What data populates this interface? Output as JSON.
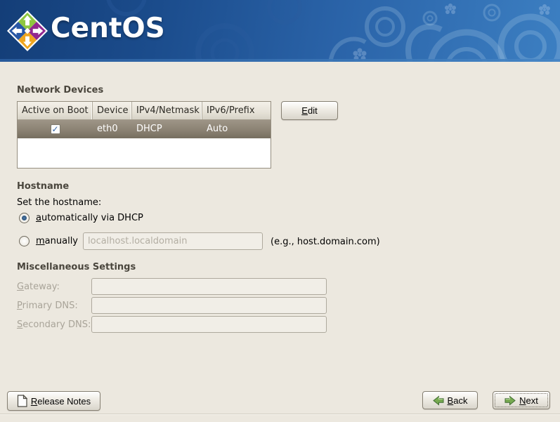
{
  "header": {
    "brand": "CentOS"
  },
  "network": {
    "title": "Network Devices",
    "edit_button": {
      "key": "E",
      "post": "dit"
    },
    "table": {
      "headers": [
        "Active on Boot",
        "Device",
        "IPv4/Netmask",
        "IPv6/Prefix"
      ],
      "rows": [
        {
          "active_on_boot": true,
          "device": "eth0",
          "ipv4": "DHCP",
          "ipv6": "Auto",
          "selected": true
        }
      ]
    }
  },
  "hostname": {
    "title": "Hostname",
    "prompt": "Set the hostname:",
    "auto_option": {
      "key": "a",
      "post": "utomatically via DHCP",
      "selected": true
    },
    "manual_option": {
      "key": "m",
      "post": "anually",
      "selected": false
    },
    "manual_input": {
      "value": "localhost.localdomain",
      "disabled": true
    },
    "example_hint": "(e.g., host.domain.com)"
  },
  "misc": {
    "title": "Miscellaneous Settings",
    "fields": [
      {
        "key": "G",
        "post": "ateway:",
        "value": "",
        "disabled": true
      },
      {
        "key": "P",
        "post": "rimary DNS:",
        "value": "",
        "disabled": true
      },
      {
        "key": "S",
        "post": "econdary DNS:",
        "value": "",
        "disabled": true
      }
    ]
  },
  "footer": {
    "release_notes": {
      "key": "R",
      "post": "elease Notes"
    },
    "back": {
      "key": "B",
      "post": "ack"
    },
    "next": {
      "key": "N",
      "post": "ext"
    }
  },
  "icons": {
    "checkbox_checked_glyph": "✓",
    "logo": "centos-four-arrows-logo",
    "release_notes": "document-page-icon",
    "back": "green-arrow-left-icon",
    "next": "green-arrow-right-icon"
  },
  "colors": {
    "header_blue_dark": "#143e78",
    "header_blue_light": "#3c7fc2",
    "selected_row": "#8b8273",
    "arrow_green": "#77aa50",
    "check_blue": "#3465a4",
    "logo_green": "#8ec63f",
    "logo_purple": "#92278f",
    "logo_orange": "#efa51f",
    "logo_blue": "#2857a4"
  }
}
